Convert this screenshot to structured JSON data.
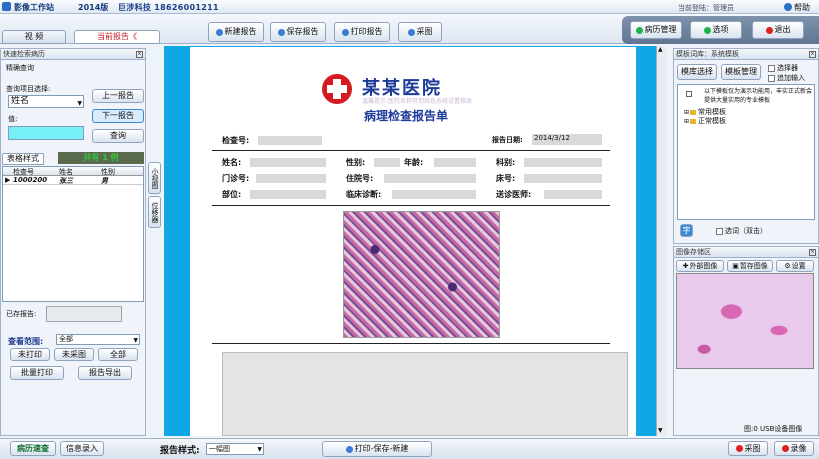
{
  "titlebar": {
    "app": "影像工作站",
    "version": "2014版",
    "company": "巨涉科技 18626001211",
    "login": "当前登陆：管理员",
    "help": "帮助"
  },
  "tabs": [
    {
      "label": "视 频"
    },
    {
      "label": "当前报告《"
    }
  ],
  "toolbar": {
    "new": "新建报告",
    "save": "保存报告",
    "print": "打印报告",
    "capture": "采图"
  },
  "rightnav": {
    "history": "病历管理",
    "options": "选项",
    "exit": "退出"
  },
  "left": {
    "panel_title": "快速检索病历",
    "query_group": "精确查询",
    "field_label": "查询项目选择:",
    "field_select": "姓名",
    "value_label": "值:",
    "prev": "上一报告",
    "next": "下一报告",
    "query": "查询",
    "table_tab": "表格样式",
    "count": "共有 1 例",
    "table": {
      "headers": [
        "检查号",
        "姓名",
        "性别"
      ],
      "rows": [
        [
          "1000200",
          "张三",
          "男"
        ]
      ]
    },
    "saved_label": "已存报告:",
    "range_label": "查看范围:",
    "range_value": "全部",
    "unprinted": "未打印",
    "uncaptured": "未采图",
    "all": "全部",
    "batch_print": "批量打印",
    "export": "报告导出"
  },
  "sidetabs": {
    "tab1": "小视图",
    "tab2": "位移器"
  },
  "report": {
    "hospital": "某某医院",
    "hospital_sub": "温馨提示:医院名称可到纯色系统设置修改",
    "title": "病理检查报告单",
    "exam_no": "检查号:",
    "report_date_label": "报告日期:",
    "report_date": "2014/3/12",
    "name": "姓名:",
    "sex": "性别:",
    "age": "年龄:",
    "dept": "科别:",
    "clinic": "门诊号:",
    "inpatient": "住院号:",
    "bed": "床号:",
    "part": "部位:",
    "diagnosis": "临床诊断:",
    "doctor": "送诊医师:"
  },
  "template": {
    "panel_title": "模板词库：系统模板",
    "select_btn": "模库选择",
    "manage_btn": "模板管理",
    "opt_select": "选择器",
    "opt_append": "追加输入",
    "note": "以下模板仅为演示功能用，丰实正式新会提供大量实用的专业模板",
    "tree": [
      "常用模板",
      "正常模板"
    ],
    "char_btn": "字",
    "dbl_click": "选词（双击）"
  },
  "image": {
    "panel_title": "图像存储区",
    "external": "外部图像",
    "temp": "暂存图像",
    "settings": "设置",
    "status": "图:0  USB设备图像"
  },
  "bottom": {
    "quick": "病历速查",
    "entry": "信息录入",
    "style_label": "报告样式:",
    "style_value": "一幅图",
    "print_save_new": "打印-保存-新建",
    "capture": "采图",
    "record": "录像"
  },
  "colors": {
    "accent_cyan": "#11a6e4",
    "hospital_red": "#d51a22",
    "report_blue": "#1c3a9a",
    "count_green": "#37c23c"
  }
}
